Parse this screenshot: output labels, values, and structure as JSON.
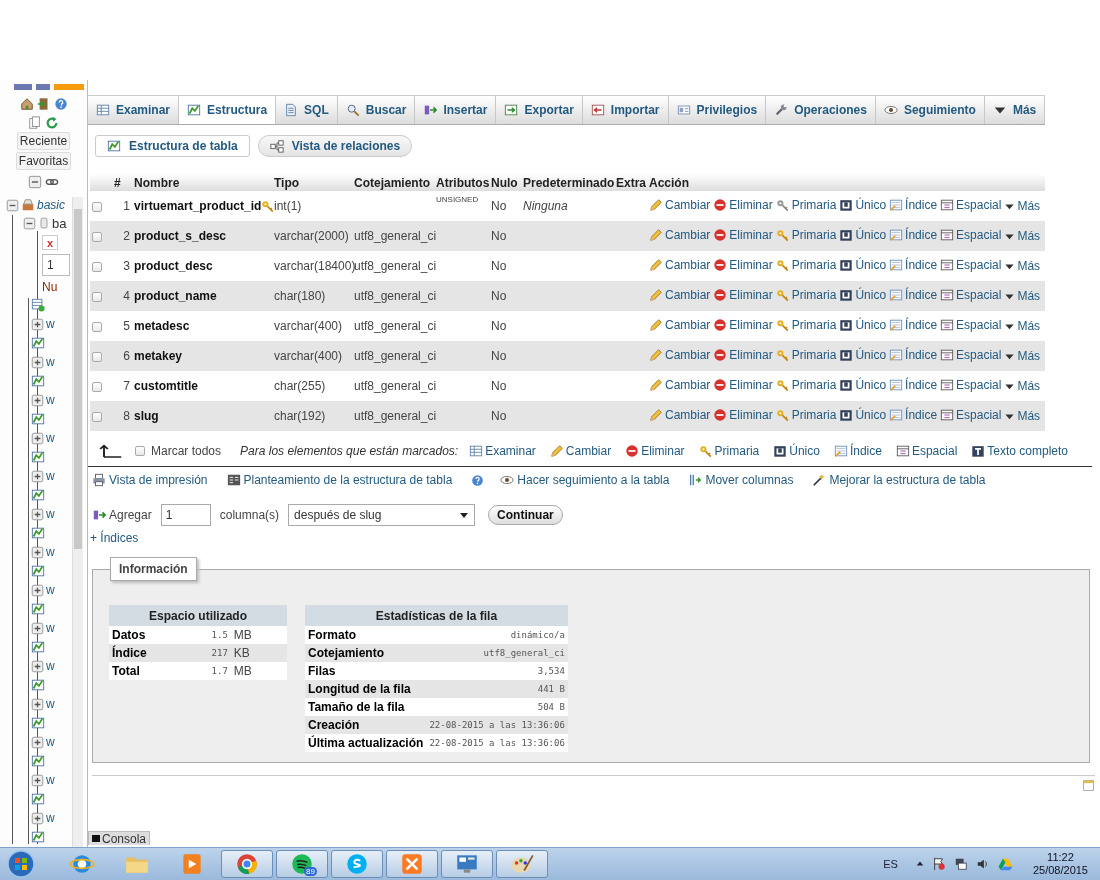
{
  "sidebar": {
    "buttons": [
      "Reciente",
      "Favoritas"
    ],
    "tree": [
      {
        "label": "basic",
        "expanded": true,
        "children": [
          {
            "label": "ba",
            "expanded": true,
            "filter_clear": "x",
            "page": "1",
            "new_label": "Nu",
            "children": [
              {
                "label": "w",
                "expanded": false
              },
              {
                "label": "w",
                "expanded": false
              },
              {
                "label": "w",
                "expanded": false
              },
              {
                "label": "w",
                "expanded": false
              },
              {
                "label": "w",
                "expanded": false
              },
              {
                "label": "w",
                "expanded": false
              },
              {
                "label": "w",
                "expanded": false
              },
              {
                "label": "w",
                "expanded": false
              },
              {
                "label": "w",
                "expanded": false
              },
              {
                "label": "w",
                "expanded": false
              },
              {
                "label": "w",
                "expanded": false
              },
              {
                "label": "w",
                "expanded": false
              },
              {
                "label": "w",
                "expanded": false
              },
              {
                "label": "w",
                "expanded": false
              }
            ]
          }
        ]
      }
    ]
  },
  "tabs": [
    {
      "label": "Examinar",
      "selected": false
    },
    {
      "label": "Estructura",
      "selected": true
    },
    {
      "label": "SQL",
      "selected": false
    },
    {
      "label": "Buscar",
      "selected": false
    },
    {
      "label": "Insertar",
      "selected": false
    },
    {
      "label": "Exportar",
      "selected": false
    },
    {
      "label": "Importar",
      "selected": false
    },
    {
      "label": "Privilegios",
      "selected": false
    },
    {
      "label": "Operaciones",
      "selected": false
    },
    {
      "label": "Seguimiento",
      "selected": false
    },
    {
      "label": "Más",
      "selected": false
    }
  ],
  "subtabs": [
    {
      "label": "Estructura de tabla",
      "selected": true
    },
    {
      "label": "Vista de relaciones",
      "selected": false
    }
  ],
  "table": {
    "columns": [
      "#",
      "Nombre",
      "Tipo",
      "Cotejamiento",
      "Atributos",
      "Nulo",
      "Predeterminado",
      "Extra",
      "Acción"
    ],
    "rows": [
      {
        "num": "1",
        "name": "virtuemart_product_id",
        "type": "int(1)",
        "collation": "",
        "attributes": "UNSIGNED",
        "null": "No",
        "default": "Ninguna",
        "primary": true,
        "checked": false,
        "actions": [
          "Cambiar",
          "Eliminar",
          "Primaria",
          "Único",
          "Índice",
          "Espacial",
          "Más"
        ]
      },
      {
        "num": "2",
        "name": "product_s_desc",
        "type": "varchar(2000)",
        "collation": "utf8_general_ci",
        "attributes": "",
        "null": "No",
        "default": "",
        "primary": false,
        "checked": false,
        "actions": [
          "Cambiar",
          "Eliminar",
          "Primaria",
          "Único",
          "Índice",
          "Espacial",
          "Más"
        ]
      },
      {
        "num": "3",
        "name": "product_desc",
        "type": "varchar(18400)",
        "collation": "utf8_general_ci",
        "attributes": "",
        "null": "No",
        "default": "",
        "primary": false,
        "checked": false,
        "actions": [
          "Cambiar",
          "Eliminar",
          "Primaria",
          "Único",
          "Índice",
          "Espacial",
          "Más"
        ]
      },
      {
        "num": "4",
        "name": "product_name",
        "type": "char(180)",
        "collation": "utf8_general_ci",
        "attributes": "",
        "null": "No",
        "default": "",
        "primary": false,
        "checked": false,
        "actions": [
          "Cambiar",
          "Eliminar",
          "Primaria",
          "Único",
          "Índice",
          "Espacial",
          "Más"
        ]
      },
      {
        "num": "5",
        "name": "metadesc",
        "type": "varchar(400)",
        "collation": "utf8_general_ci",
        "attributes": "",
        "null": "No",
        "default": "",
        "primary": false,
        "checked": false,
        "actions": [
          "Cambiar",
          "Eliminar",
          "Primaria",
          "Único",
          "Índice",
          "Espacial",
          "Más"
        ]
      },
      {
        "num": "6",
        "name": "metakey",
        "type": "varchar(400)",
        "collation": "utf8_general_ci",
        "attributes": "",
        "null": "No",
        "default": "",
        "primary": false,
        "checked": false,
        "actions": [
          "Cambiar",
          "Eliminar",
          "Primaria",
          "Único",
          "Índice",
          "Espacial",
          "Más"
        ]
      },
      {
        "num": "7",
        "name": "customtitle",
        "type": "char(255)",
        "collation": "utf8_general_ci",
        "attributes": "",
        "null": "No",
        "default": "",
        "primary": false,
        "checked": false,
        "actions": [
          "Cambiar",
          "Eliminar",
          "Primaria",
          "Único",
          "Índice",
          "Espacial",
          "Más"
        ]
      },
      {
        "num": "8",
        "name": "slug",
        "type": "char(192)",
        "collation": "utf8_general_ci",
        "attributes": "",
        "null": "No",
        "default": "",
        "primary": false,
        "checked": false,
        "actions": [
          "Cambiar",
          "Eliminar",
          "Primaria",
          "Único",
          "Índice",
          "Espacial",
          "Más"
        ]
      }
    ]
  },
  "bulk": {
    "check_all": "Marcar todos",
    "check_all_checked": false,
    "prompt": "Para los elementos que están marcados:",
    "actions": [
      "Examinar",
      "Cambiar",
      "Eliminar",
      "Primaria",
      "Único",
      "Índice",
      "Espacial",
      "Texto completo"
    ]
  },
  "links": [
    "Vista de impresión",
    "Planteamiento de la estructura de tabla",
    "Hacer seguimiento a la tabla",
    "Mover columnas",
    "Mejorar la estructura de tabla"
  ],
  "add_column": {
    "label": "Agregar",
    "count": "1",
    "unit": "columna(s)",
    "position": "después de slug",
    "button": "Continuar"
  },
  "indexes_link": "+ Índices",
  "info": {
    "legend": "Información",
    "space": {
      "title": "Espacio utilizado",
      "rows": [
        {
          "label": "Datos",
          "value": "1.5",
          "unit": "MB"
        },
        {
          "label": "Índice",
          "value": "217",
          "unit": "KB"
        },
        {
          "label": "Total",
          "value": "1.7",
          "unit": "MB"
        }
      ]
    },
    "stats": {
      "title": "Estadísticas de la fila",
      "rows": [
        {
          "label": "Formato",
          "value": "dinámico/a"
        },
        {
          "label": "Cotejamiento",
          "value": "utf8_general_ci"
        },
        {
          "label": "Filas",
          "value": "3,534"
        },
        {
          "label": "Longitud de la fila",
          "value": "441 B"
        },
        {
          "label": "Tamaño de la fila",
          "value": "504 B"
        },
        {
          "label": "Creación",
          "value": "22-08-2015 a las 13:36:06"
        },
        {
          "label": "Última actualización",
          "value": "22-08-2015 a las 13:36:06"
        }
      ]
    }
  },
  "console": "Consola",
  "taskbar": {
    "apps": [
      {
        "kind": "ie",
        "running": false
      },
      {
        "kind": "folder",
        "running": false
      },
      {
        "kind": "media",
        "running": false
      },
      {
        "kind": "chrome",
        "running": true
      },
      {
        "kind": "spotify",
        "running": true,
        "badge": "89"
      },
      {
        "kind": "skype",
        "running": true
      },
      {
        "kind": "xampp",
        "running": true
      },
      {
        "kind": "panel",
        "running": true
      },
      {
        "kind": "paint",
        "running": true
      }
    ],
    "language": "ES",
    "time": "11:22",
    "date": "25/08/2015"
  }
}
